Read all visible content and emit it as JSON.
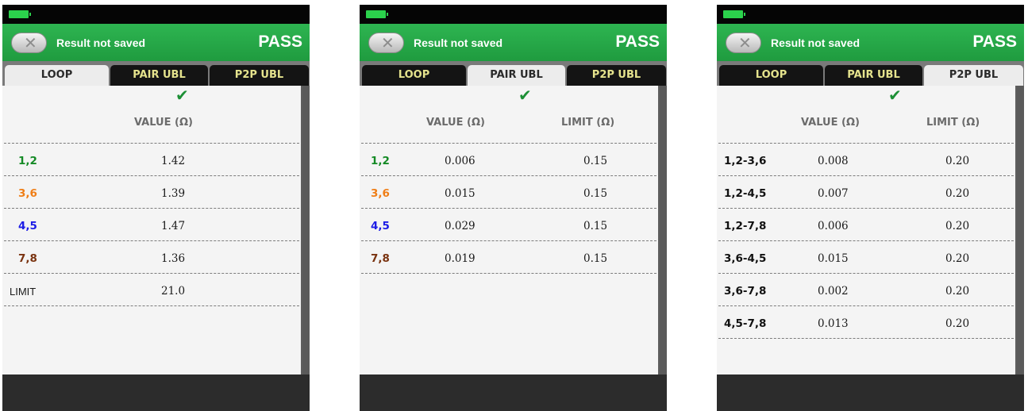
{
  "colors": {
    "pair_1_2": "#148a25",
    "pair_3_6": "#ef7e17",
    "pair_4_5": "#1c1ce6",
    "pair_7_8": "#7a3310",
    "pass_green": "#22a847",
    "tab_inactive_text": "#e5e38d",
    "p2p_text": "#111111"
  },
  "screens": [
    {
      "header": {
        "message": "Result not saved",
        "status": "PASS",
        "back_icon": "close-x-icon"
      },
      "tabs": [
        "LOOP",
        "PAIR UBL",
        "P2P UBL"
      ],
      "active_tab": 0,
      "check_icon": "checkmark-icon",
      "columns": {
        "value": "VALUE (Ω)",
        "limit": ""
      },
      "rows": [
        {
          "label": "1,2",
          "value": "1.42",
          "limit": ""
        },
        {
          "label": "3,6",
          "value": "1.39",
          "limit": ""
        },
        {
          "label": "4,5",
          "value": "1.47",
          "limit": ""
        },
        {
          "label": "7,8",
          "value": "1.36",
          "limit": ""
        }
      ],
      "limit_row": {
        "label": "LIMIT",
        "value": "21.0"
      }
    },
    {
      "header": {
        "message": "Result not saved",
        "status": "PASS",
        "back_icon": "close-x-icon"
      },
      "tabs": [
        "LOOP",
        "PAIR UBL",
        "P2P UBL"
      ],
      "active_tab": 1,
      "check_icon": "checkmark-icon",
      "columns": {
        "value": "VALUE (Ω)",
        "limit": "LIMIT (Ω)"
      },
      "rows": [
        {
          "label": "1,2",
          "value": "0.006",
          "limit": "0.15"
        },
        {
          "label": "3,6",
          "value": "0.015",
          "limit": "0.15"
        },
        {
          "label": "4,5",
          "value": "0.029",
          "limit": "0.15"
        },
        {
          "label": "7,8",
          "value": "0.019",
          "limit": "0.15"
        }
      ]
    },
    {
      "header": {
        "message": "Result not saved",
        "status": "PASS",
        "back_icon": "close-x-icon"
      },
      "tabs": [
        "LOOP",
        "PAIR UBL",
        "P2P UBL"
      ],
      "active_tab": 2,
      "check_icon": "checkmark-icon",
      "columns": {
        "value": "VALUE (Ω)",
        "limit": "LIMIT (Ω)"
      },
      "rows": [
        {
          "label": "1,2-3,6",
          "value": "0.008",
          "limit": "0.20"
        },
        {
          "label": "1,2-4,5",
          "value": "0.007",
          "limit": "0.20"
        },
        {
          "label": "1,2-7,8",
          "value": "0.006",
          "limit": "0.20"
        },
        {
          "label": "3,6-4,5",
          "value": "0.015",
          "limit": "0.20"
        },
        {
          "label": "3,6-7,8",
          "value": "0.002",
          "limit": "0.20"
        },
        {
          "label": "4,5-7,8",
          "value": "0.013",
          "limit": "0.20"
        }
      ]
    }
  ]
}
